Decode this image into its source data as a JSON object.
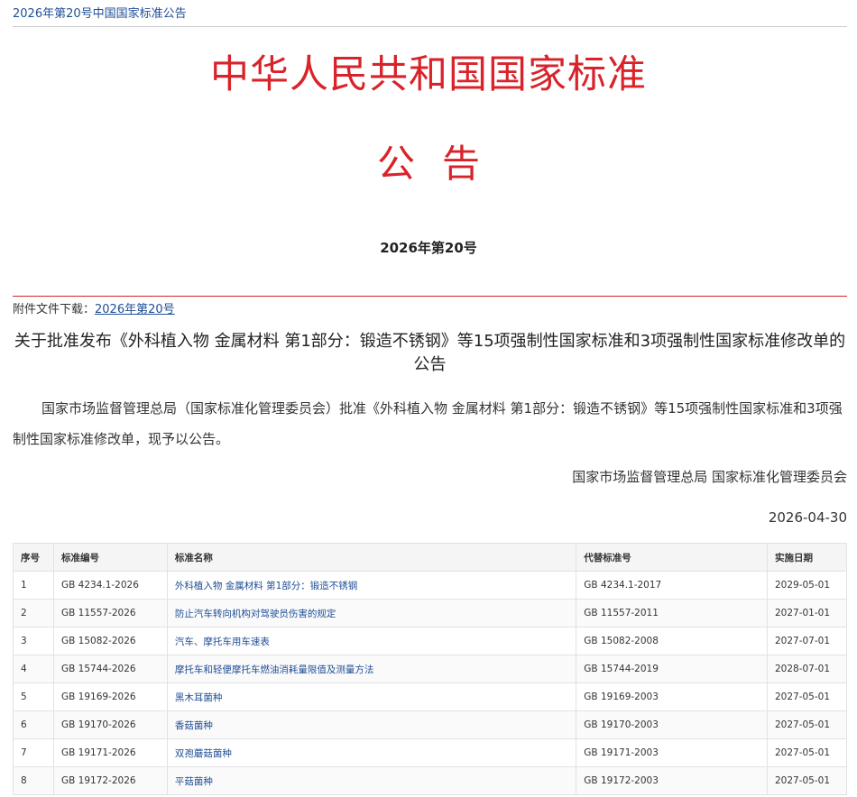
{
  "breadcrumb": "2026年第20号中国国家标准公告",
  "headline": "中华人民共和国国家标准",
  "announce_title": "公告",
  "issue_no": "2026年第20号",
  "attachment": {
    "label": "附件文件下载：",
    "link": "2026年第20号"
  },
  "doc_title": "关于批准发布《外科植入物 金属材料 第1部分：锻造不锈钢》等15项强制性国家标准和3项强制性国家标准修改单的公告",
  "body": "国家市场监督管理总局（国家标准化管理委员会）批准《外科植入物 金属材料 第1部分：锻造不锈钢》等15项强制性国家标准和3项强制性国家标准修改单，现予以公告。",
  "signer": "国家市场监督管理总局 国家标准化管理委员会",
  "date": "2026-04-30",
  "colors": {
    "accent_red": "#d9232a",
    "link_blue": "#1f4e96"
  },
  "table": {
    "headers": [
      "序号",
      "标准编号",
      "标准名称",
      "代替标准号",
      "实施日期"
    ],
    "rows": [
      [
        "1",
        "GB 4234.1-2026",
        "外科植入物 金属材料 第1部分：锻造不锈钢",
        "GB 4234.1-2017",
        "2029-05-01"
      ],
      [
        "2",
        "GB 11557-2026",
        "防止汽车转向机构对驾驶员伤害的规定",
        "GB 11557-2011",
        "2027-01-01"
      ],
      [
        "3",
        "GB 15082-2026",
        "汽车、摩托车用车速表",
        "GB 15082-2008",
        "2027-07-01"
      ],
      [
        "4",
        "GB 15744-2026",
        "摩托车和轻便摩托车燃油消耗量限值及测量方法",
        "GB 15744-2019",
        "2028-07-01"
      ],
      [
        "5",
        "GB 19169-2026",
        "黑木耳菌种",
        "GB 19169-2003",
        "2027-05-01"
      ],
      [
        "6",
        "GB 19170-2026",
        "香菇菌种",
        "GB 19170-2003",
        "2027-05-01"
      ],
      [
        "7",
        "GB 19171-2026",
        "双孢蘑菇菌种",
        "GB 19171-2003",
        "2027-05-01"
      ],
      [
        "8",
        "GB 19172-2026",
        "平菇菌种",
        "GB 19172-2003",
        "2027-05-01"
      ]
    ]
  }
}
